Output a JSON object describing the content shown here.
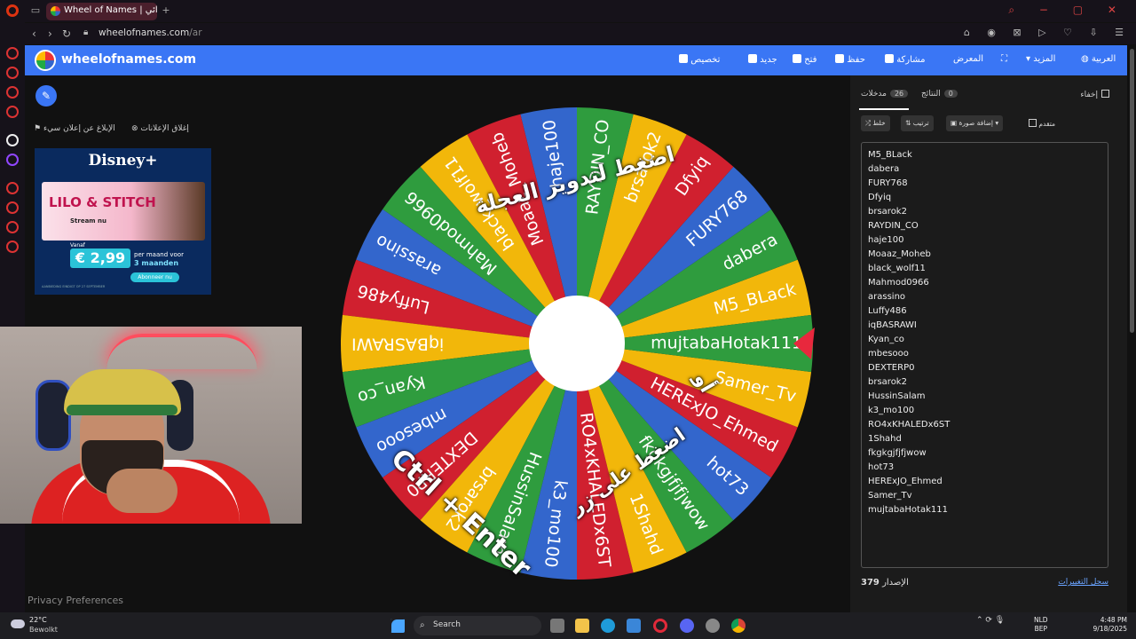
{
  "browser": {
    "tab_title": "Wheel of Names | عجلة العشوائي",
    "new_tab": "+",
    "url_domain": "wheelofnames.com",
    "url_path": "/ar"
  },
  "header": {
    "site_name": "wheelofnames.com",
    "customize": "تخصيص",
    "new": "جديد",
    "open": "فتح",
    "save": "حفظ",
    "share": "مشاركة",
    "gallery": "المعرض",
    "more": "المزيد",
    "language": "العربية"
  },
  "ads": {
    "close_label": "إغلاق الإعلانات",
    "report_label": "الإبلاغ عن إعلان سيء",
    "brand": "Disney+",
    "title": "LILO & STITCH",
    "stream": "Stream nu",
    "vanaf": "Vanaf",
    "price": "€ 2,99",
    "per_month": "per maand voor",
    "months": "3 maanden",
    "cta": "Abonneer nu",
    "fine_print": "AANBIEDING EINDIGT OP 27 SEPTEMBER"
  },
  "privacy_label": "Privacy Preferences",
  "wheel": {
    "pointer_color": "#e8283d",
    "colors": [
      "#2f9c3e",
      "#3366cc",
      "#d0202f",
      "#f2b70a"
    ],
    "overlay_spin": "اضغط لتدوير العجلة",
    "overlay_or": "أو",
    "overlay_press": "اضغط على زر",
    "overlay_keys": "Ctrl + Enter"
  },
  "panel": {
    "tab_entries": "مدخلات",
    "tab_entries_count": "26",
    "tab_results": "النتائج",
    "tab_results_count": "0",
    "hide": "إخفاء",
    "shuffle": "خلط",
    "sort": "ترتيب",
    "add_image": "إضافة صورة",
    "advanced": "متقدم",
    "version_label": "الإصدار",
    "version": "379",
    "changelog": "سجل التغييرات"
  },
  "entries": [
    "M5_BLack",
    "dabera",
    "FURY768",
    "Dfyiq",
    "brsarok2",
    "RAYDIN_CO",
    "haje100",
    "Moaaz_Moheb",
    "black_wolf11",
    "Mahmod0966",
    "arassino",
    "Luffy486",
    "iqBASRAWI",
    "Kyan_co",
    "mbesooo",
    "DEXTERP0",
    "brsarok2",
    "HussinSalam",
    "k3_mo100",
    "RO4xKHALEDx6ST",
    "1Shahd",
    "fkgkgjfjfjwow",
    "hot73",
    "HERExJO_Ehmed",
    "Samer_Tv",
    "mujtabaHotak111"
  ],
  "taskbar": {
    "temp": "22°C",
    "weather": "Bewolkt",
    "search": "Search",
    "lang1": "NLD",
    "lang2": "BEP",
    "time": "4:48 PM",
    "date": "9/18/2025"
  }
}
